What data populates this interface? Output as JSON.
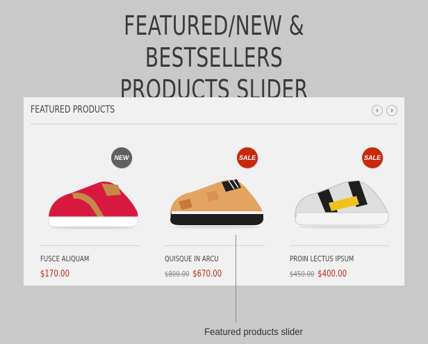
{
  "headline": {
    "line1": "FEATURED/NEW & BESTSELLERS",
    "line2": "PRODUCTS SLIDER"
  },
  "panel": {
    "title": "FEATURED PRODUCTS",
    "prev_icon": "chevron-left-icon",
    "next_icon": "chevron-right-icon"
  },
  "products": [
    {
      "name": "FUSCE ALIQUAM",
      "price": "$170.00",
      "old_price": "",
      "badge": "NEW",
      "badge_color": "#606060",
      "shoe_colors": {
        "upper": "#d8193f",
        "accent": "#c58a4a",
        "sole": "#ffffff"
      }
    },
    {
      "name": "QUISQUE IN ARCU",
      "price": "$670.00",
      "old_price": "$800.00",
      "badge": "SALE",
      "badge_color": "#c9290b",
      "shoe_colors": {
        "upper": "#e2a460",
        "accent": "#1e1e1e",
        "sole": "#f4f4f4"
      }
    },
    {
      "name": "PROIN LECTUS IPSUM",
      "price": "$400.00",
      "old_price": "$450.00",
      "badge": "SALE",
      "badge_color": "#c9290b",
      "shoe_colors": {
        "upper": "#dedede",
        "accent": "#1e1e1e",
        "sole": "#f4f4f4"
      }
    }
  ],
  "caption": "Featured products slider",
  "colors": {
    "background": "#c9c9c9",
    "panel": "#f1f1f1",
    "price_red": "#c0281b"
  }
}
